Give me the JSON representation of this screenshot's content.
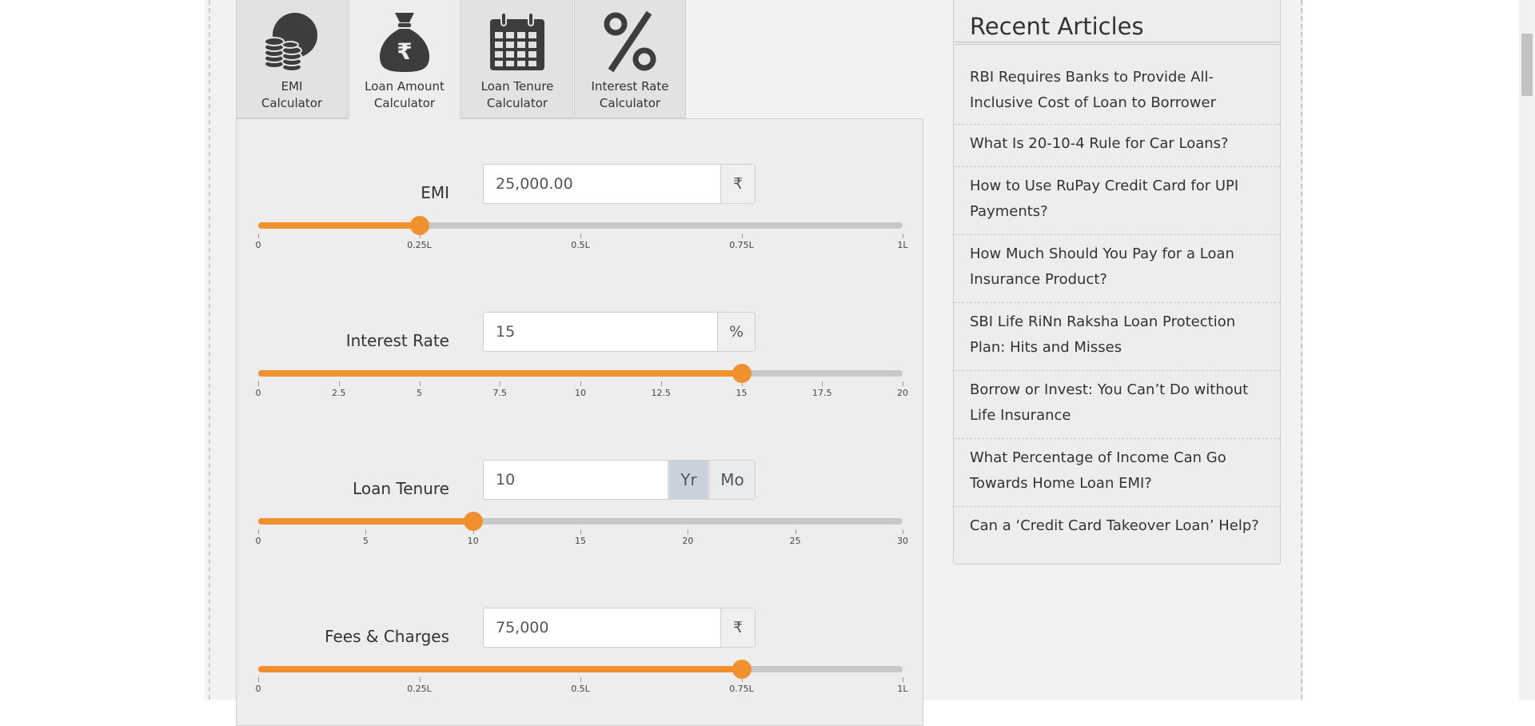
{
  "tabs": [
    {
      "label": "EMI\nCalculator",
      "icon": "coins-icon"
    },
    {
      "label": "Loan Amount\nCalculator",
      "icon": "money-bag-icon"
    },
    {
      "label": "Loan Tenure\nCalculator",
      "icon": "calendar-icon"
    },
    {
      "label": "Interest Rate\nCalculator",
      "icon": "percent-icon"
    }
  ],
  "fields": {
    "emi": {
      "label": "EMI",
      "value": "25,000.00",
      "unit": "₹",
      "slider": {
        "min": 0,
        "max": 100000,
        "value": 25000,
        "ticks": [
          "0",
          "0.25L",
          "0.5L",
          "0.75L",
          "1L"
        ]
      }
    },
    "interest": {
      "label": "Interest Rate",
      "value": "15",
      "unit": "%",
      "slider": {
        "min": 0,
        "max": 20,
        "value": 15,
        "ticks": [
          "0",
          "2.5",
          "5",
          "7.5",
          "10",
          "12.5",
          "15",
          "17.5",
          "20"
        ]
      }
    },
    "tenure": {
      "label": "Loan Tenure",
      "value": "10",
      "unit_year": "Yr",
      "unit_month": "Mo",
      "slider": {
        "min": 0,
        "max": 30,
        "value": 10,
        "ticks": [
          "0",
          "5",
          "10",
          "15",
          "20",
          "25",
          "30"
        ]
      }
    },
    "fees": {
      "label": "Fees & Charges",
      "value": "75,000",
      "unit": "₹",
      "slider": {
        "min": 0,
        "max": 100000,
        "value": 75000,
        "ticks": [
          "0",
          "0.25L",
          "0.5L",
          "0.75L",
          "1L"
        ]
      }
    }
  },
  "sidebar": {
    "title": "Recent Articles",
    "articles": [
      "RBI Requires Banks to Provide All-Inclusive Cost of Loan to Borrower",
      "What Is 20-10-4 Rule for Car Loans?",
      "How to Use RuPay Credit Card for UPI Payments?",
      "How Much Should You Pay for a Loan Insurance Product?",
      "SBI Life RiNn Raksha Loan Protection Plan: Hits and Misses",
      "Borrow or Invest: You Can’t Do without Life Insurance",
      "What Percentage of Income Can Go Towards Home Loan EMI?",
      "Can a ‘Credit Card Takeover Loan’ Help?"
    ]
  },
  "colors": {
    "accent": "#f0902e",
    "track": "#c8c8c8",
    "panel": "#ededed"
  }
}
